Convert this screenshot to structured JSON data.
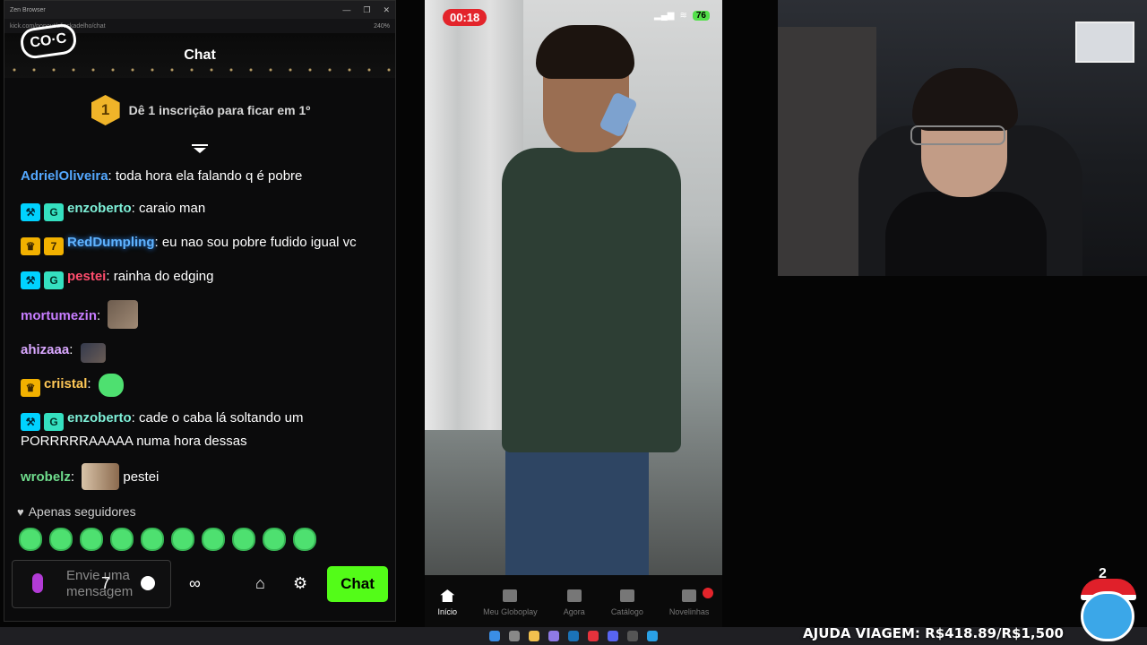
{
  "browser": {
    "window_title": "Zen Browser",
    "url": "kick.com/popout/aliaskadelho/chat",
    "zoom": "240%",
    "controls": [
      "—",
      "❐",
      "✕"
    ]
  },
  "chat": {
    "title": "Chat",
    "logo_text": "CO·C",
    "promo_rank": "1",
    "promo_text": "Dê 1 inscrição para ficar em 1º",
    "messages": [
      {
        "user": "AdrielOliveira",
        "color": "#54a8ff",
        "badges": [],
        "text": "toda hora ela falando q é pobre"
      },
      {
        "user": "enzoberto",
        "color": "#7ef0d8",
        "badges": [
          "mod",
          "sub"
        ],
        "text": "caraio man"
      },
      {
        "user": "RedDumpling",
        "color": "#5fb3ff",
        "badges": [
          "crown",
          "gift"
        ],
        "text": "eu nao sou pobre fudido igual vc"
      },
      {
        "user": "pestei",
        "color": "#ff4d6d",
        "badges": [
          "mod",
          "sub"
        ],
        "text": "rainha do edging"
      },
      {
        "user": "mortumezin",
        "color": "#c77dff",
        "badges": [],
        "text": ""
      },
      {
        "user": "ahizaaa",
        "color": "#d9a7ff",
        "badges": [],
        "text": ""
      },
      {
        "user": "criistal",
        "color": "#ffc857",
        "badges": [
          "crown"
        ],
        "text": ""
      },
      {
        "user": "enzoberto",
        "color": "#7ef0d8",
        "badges": [
          "mod",
          "sub"
        ],
        "text": "cade o caba lá soltando um PORRRRRAAAAA numa hora dessas"
      },
      {
        "user": "wrobelz",
        "color": "#6fdc8c",
        "badges": [],
        "text": "pestei"
      }
    ],
    "followers_only": "Apenas seguidores",
    "input_placeholder": "Envie uma mensagem",
    "send_label": "Chat",
    "tools": [
      "7",
      "∞",
      "⌂",
      "⚙"
    ]
  },
  "phone": {
    "timer": "00:18",
    "battery": "76",
    "progress": 0.2,
    "nav": [
      {
        "label": "Início",
        "icon": "home-icon",
        "active": true
      },
      {
        "label": "Meu Globoplay",
        "icon": "folder-icon",
        "active": false
      },
      {
        "label": "Agora",
        "icon": "live-icon",
        "active": false
      },
      {
        "label": "Catálogo",
        "icon": "catalog-icon",
        "active": false
      },
      {
        "label": "Novelinhas",
        "icon": "novelinhas-icon",
        "active": false
      }
    ]
  },
  "overlay": {
    "goal_text": "AJUDA VIAGEM: R$418.89/R$1,500",
    "mascot_count": "2"
  },
  "colors": {
    "kick_green": "#53fc18",
    "recording_red": "#e3242b",
    "sub_gold": "#f0b429"
  }
}
